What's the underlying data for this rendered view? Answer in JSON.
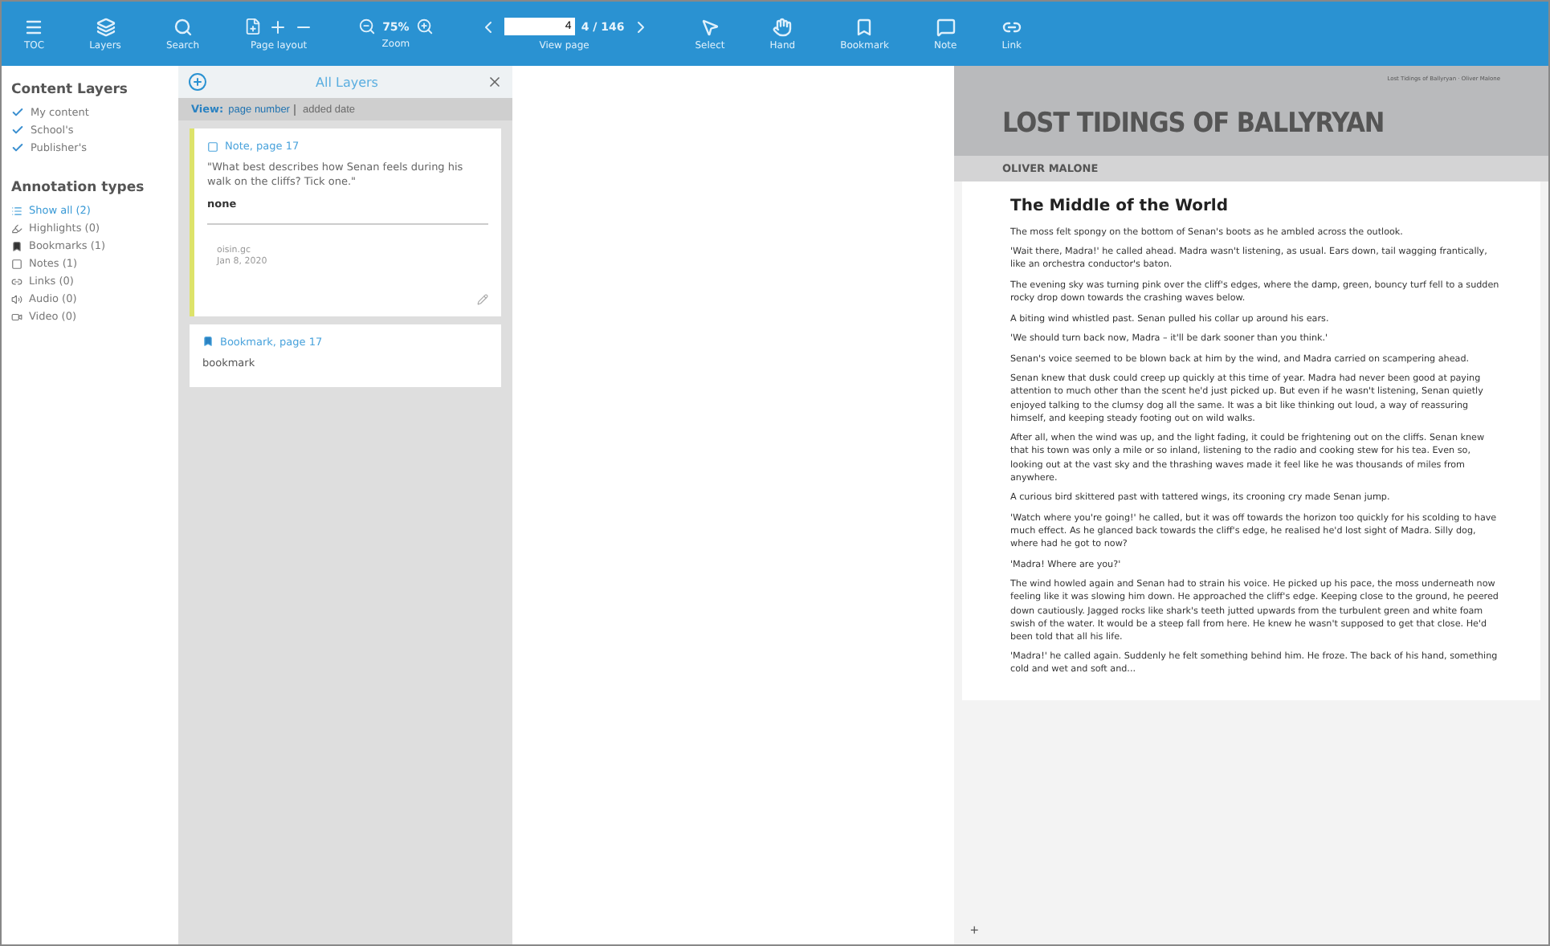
{
  "toolbar": {
    "groups": [
      {
        "kind": "toc",
        "label": "TOC"
      },
      {
        "kind": "layers",
        "label": "Layers"
      },
      {
        "kind": "search",
        "label": "Search"
      },
      {
        "kind": "layout",
        "label": "Page layout"
      },
      {
        "kind": "zoom",
        "label": "Zoom",
        "value": "75%"
      },
      {
        "kind": "goto",
        "label": "View page",
        "value": "4",
        "total": "4 / 146"
      },
      {
        "kind": "select",
        "label": "Select"
      },
      {
        "kind": "hand",
        "label": "Hand"
      },
      {
        "kind": "bookmark",
        "label": "Bookmark"
      },
      {
        "kind": "note",
        "label": "Note"
      },
      {
        "kind": "link",
        "label": "Link"
      }
    ]
  },
  "sidebar": {
    "content_title": "Content Layers",
    "layers": [
      {
        "label": "My content",
        "checked": true
      },
      {
        "label": "School's",
        "checked": true
      },
      {
        "label": "Publisher's",
        "checked": true
      }
    ],
    "annotation_title": "Annotation types",
    "types": [
      {
        "kind": "all",
        "label": "Show all (2)",
        "selected": true
      },
      {
        "kind": "highlight",
        "label": "Highlights (0)",
        "selected": false
      },
      {
        "kind": "bookmark",
        "label": "Bookmarks (1)",
        "selected": false
      },
      {
        "kind": "note",
        "label": "Notes (1)",
        "selected": false
      },
      {
        "kind": "link",
        "label": "Links (0)",
        "selected": false
      },
      {
        "kind": "audio",
        "label": "Audio (0)",
        "selected": false
      },
      {
        "kind": "video",
        "label": "Video (0)",
        "selected": false
      }
    ]
  },
  "layers_panel": {
    "title": "All Layers",
    "view_label": "View:",
    "views": [
      {
        "label": "page number",
        "selected": true
      },
      {
        "label": "added date",
        "selected": false
      }
    ],
    "cards": [
      {
        "kind": "note",
        "title": "Note, page 17",
        "quote": "\"What best describes how Senan feels during his walk on the cliffs? Tick one.\"",
        "answer": "none",
        "user": "oisin.gc",
        "date": "Jan 8, 2020"
      },
      {
        "kind": "bookmark",
        "title": "Bookmark, page 17",
        "body": "bookmark"
      }
    ]
  },
  "page": {
    "running_head": "Lost Tidings of Ballyryan · Oliver Malone",
    "title": "LOST TIDINGS OF BALLYRYAN",
    "author": "OLIVER MALONE",
    "chapter": "The Middle of the World",
    "paragraphs": [
      "The moss felt spongy on the bottom of Senan's boots as he ambled across the outlook.",
      "'Wait there, Madra!' he called ahead. Madra wasn't listening, as usual. Ears down, tail wagging frantically, like an orchestra conductor's baton.",
      "The evening sky was turning pink over the cliff's edges, where the damp, green, bouncy turf fell to a sudden rocky drop down towards the crashing waves below.",
      "A biting wind whistled past. Senan pulled his collar up around his ears.",
      "'We should turn back now, Madra – it'll be dark sooner than you think.'",
      "Senan's voice seemed to be blown back at him by the wind, and Madra carried on scampering ahead.",
      "Senan knew that dusk could creep up quickly at this time of year. Madra had never been good at paying attention to much other than the scent he'd just picked up. But even if he wasn't listening, Senan quietly enjoyed talking to the clumsy dog all the same. It was a bit like thinking out loud, a way of reassuring himself, and keeping steady footing out on wild walks.",
      "After all, when the wind was up, and the light fading, it could be frightening out on the cliffs. Senan knew that his town was only a mile or so inland, listening to the radio and cooking stew for his tea. Even so, looking out at the vast sky and the thrashing waves made it feel like he was thousands of miles from anywhere.",
      "A curious bird skittered past with tattered wings, its crooning cry made Senan jump.",
      "'Watch where you're going!' he called, but it was off towards the horizon too quickly for his scolding to have much effect. As he glanced back towards the cliff's edge, he realised he'd lost sight of Madra. Silly dog, where had he got to now?",
      "'Madra! Where are you?'",
      "The wind howled again and Senan had to strain his voice. He picked up his pace, the moss underneath now feeling like it was slowing him down. He approached the cliff's edge. Keeping close to the ground, he peered down cautiously. Jagged rocks like shark's teeth jutted upwards from the turbulent green and white foam swish of the water. It would be a steep fall from here. He knew he wasn't supposed to get that close. He'd been told that all his life.",
      "'Madra!' he called again. Suddenly he felt something behind him. He froze. The back of his hand, something cold and wet and soft and..."
    ],
    "add_button": "+"
  }
}
